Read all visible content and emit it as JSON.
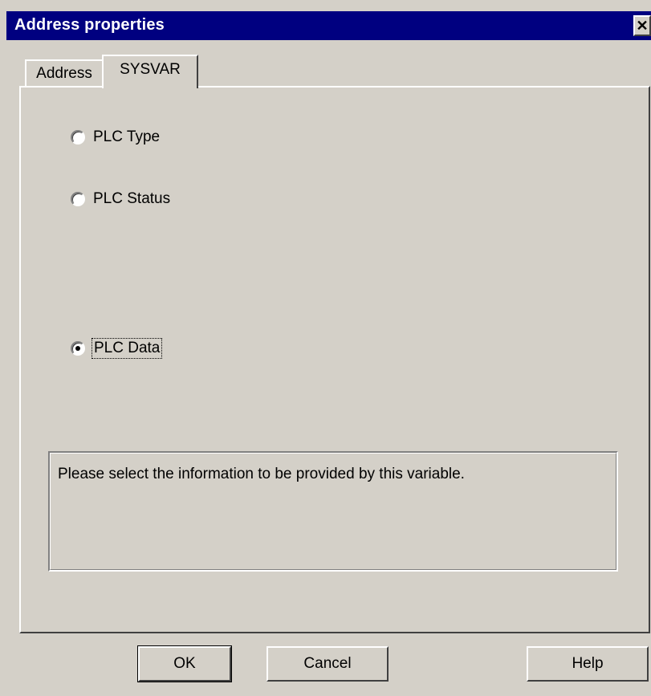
{
  "window": {
    "title": "Address properties",
    "close_symbol": "✕"
  },
  "tabs": [
    {
      "label": "Address",
      "active": false
    },
    {
      "label": "SYSVAR",
      "active": true
    }
  ],
  "options": [
    {
      "label": "PLC Type",
      "checked": false
    },
    {
      "label": "PLC Status",
      "checked": false
    },
    {
      "label": "PLC Data",
      "checked": true
    }
  ],
  "info_text": "Please select the information to be provided by this variable.",
  "buttons": {
    "ok": "OK",
    "cancel": "Cancel",
    "help": "Help"
  },
  "colors": {
    "titlebar": "#000080",
    "face": "#d4d0c8"
  }
}
